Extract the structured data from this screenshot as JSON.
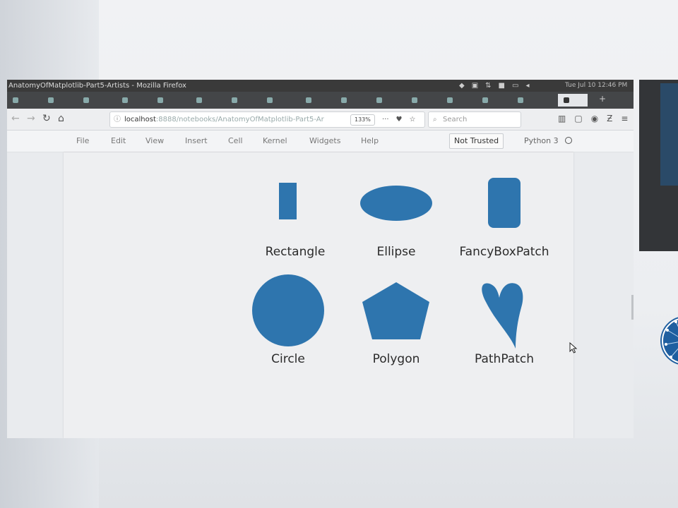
{
  "window": {
    "title": "AnatomyOfMatplotlib-Part5-Artists - Mozilla Firefox",
    "clock": "Tue Jul 10 12:46 PM"
  },
  "browser": {
    "url_host": "localhost",
    "url_path": ":8888/notebooks/AnatomyOfMatplotlib-Part5-Ar",
    "zoom": "133%",
    "search_placeholder": "Search",
    "menu_dots": "···"
  },
  "jupyter": {
    "menu": [
      "File",
      "Edit",
      "View",
      "Insert",
      "Cell",
      "Kernel",
      "Widgets",
      "Help"
    ],
    "trust_badge": "Not Trusted",
    "kernel": "Python 3"
  },
  "figure": {
    "shapes": [
      {
        "label": "Rectangle",
        "icon": "rectangle-patch"
      },
      {
        "label": "Ellipse",
        "icon": "ellipse-patch"
      },
      {
        "label": "FancyBoxPatch",
        "icon": "fancybox-patch"
      },
      {
        "label": "Circle",
        "icon": "circle-patch"
      },
      {
        "label": "Polygon",
        "icon": "polygon-patch"
      },
      {
        "label": "PathPatch",
        "icon": "path-patch"
      }
    ],
    "fill_color": "#2e75ae"
  },
  "colors": {
    "titlebar": "#3a3a3a",
    "tabbar": "#444648",
    "patch_blue": "#2e75ae"
  }
}
